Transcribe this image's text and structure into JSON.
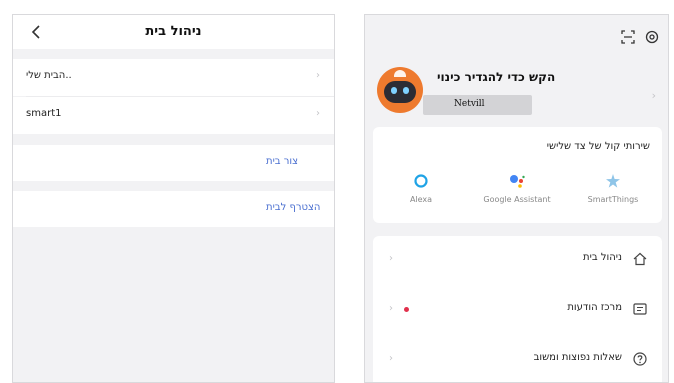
{
  "left": {
    "header": {
      "back_icon": "chevron-left-icon",
      "title": "ניהול בית"
    },
    "homes": [
      {
        "name": "הבית שלי.."
      },
      {
        "name": "smart1"
      }
    ],
    "actions": {
      "create_home": "צור בית",
      "join_home": "הצטרף לבית"
    }
  },
  "right": {
    "top_icons": [
      "scan-icon",
      "settings-icon"
    ],
    "profile": {
      "prompt": "הקש כדי להגדיר כינוי",
      "nickname": "Netvill"
    },
    "voice_services": {
      "title": "שירותי קול של צד שלישי",
      "items": [
        {
          "name": "Alexa",
          "icon": "alexa-icon"
        },
        {
          "name": "Google Assistant",
          "icon": "google-assistant-icon"
        },
        {
          "name": "SmartThings",
          "icon": "smartthings-icon"
        }
      ]
    },
    "menu": [
      {
        "label": "ניהול בית",
        "icon": "home-icon"
      },
      {
        "label": "מרכז הודעות",
        "icon": "message-icon",
        "unread_dot": true
      },
      {
        "label": "שאלות נפוצות ומשוב",
        "icon": "help-icon"
      }
    ]
  },
  "colors": {
    "accent_link": "#4a6fd0",
    "avatar": "#ee7a2e",
    "badge": "#e1304c",
    "background": "#f2f2f4"
  }
}
